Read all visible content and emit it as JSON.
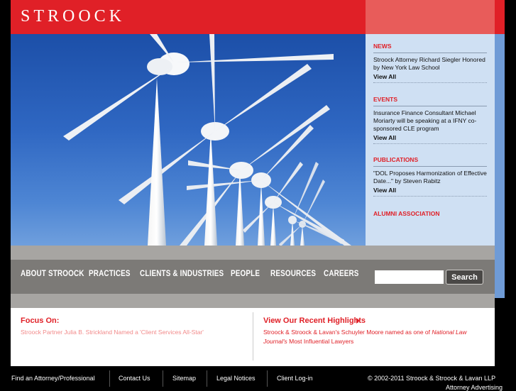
{
  "header": {
    "logo": "STROOCK"
  },
  "side_panel": {
    "news": {
      "title": "NEWS",
      "text": "Stroock Attorney Richard Siegler Honored by New York Law School",
      "link": "View All"
    },
    "events": {
      "title": "EVENTS",
      "text": "Insurance Finance Consultant Michael Moriarty will be speaking at a IFNY co-sponsored CLE program",
      "link": "View All"
    },
    "publications": {
      "title": "PUBLICATIONS",
      "text": "\"DOL Proposes Harmonization of Effective Date...\" by Steven Rabitz",
      "link": "View All"
    },
    "alumni": "ALUMNI ASSOCIATION"
  },
  "nav": {
    "items": [
      "ABOUT STROOCK",
      "PRACTICES",
      "CLIENTS & INDUSTRIES",
      "PEOPLE",
      "RESOURCES",
      "CAREERS"
    ],
    "search_value": "",
    "search_button": "Search"
  },
  "focus": {
    "title": "Focus On:",
    "text": "Stroock Partner Julia B. Strickland Named a 'Client Services All-Star'"
  },
  "highlights": {
    "title": "View Our Recent Highlights",
    "text_before": "Stroock & Stroock & Lavan's Schuyler Moore named as one of ",
    "text_italic": "National Law Journal's",
    "text_after": " Most Influential Lawyers"
  },
  "footer": {
    "links": [
      "Find an Attorney/Professional",
      "Contact Us",
      "Sitemap",
      "Legal Notices",
      "Client Log-in"
    ],
    "copyright": "© 2002-2011 Stroock & Stroock & Lavan LLP",
    "extra": "Attorney Advertising"
  },
  "colors": {
    "brand_red": "#e02027",
    "sky_blue": "#2f67c2",
    "panel_blue": "#cfe0f3",
    "nav_gray": "#7c7a77"
  }
}
